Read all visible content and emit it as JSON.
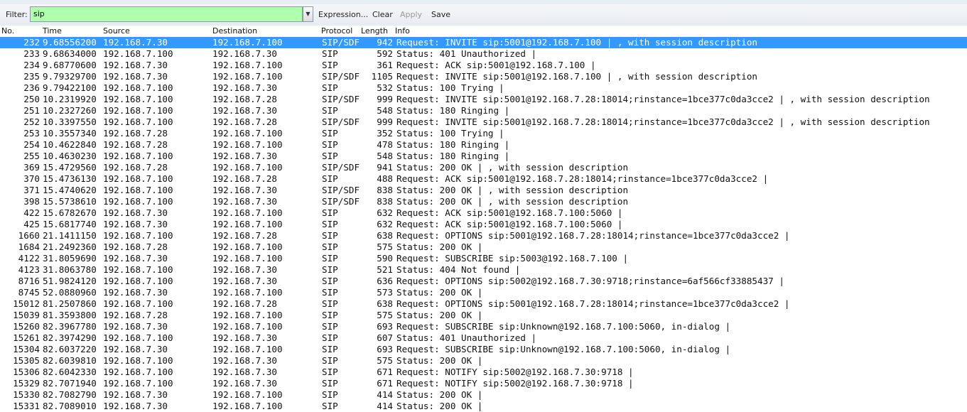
{
  "filter": {
    "label": "Filter:",
    "value": "sip",
    "expression_label": "Expression...",
    "clear_label": "Clear",
    "apply_label": "Apply",
    "save_label": "Save",
    "valid_color": "#afffaf"
  },
  "columns": {
    "no": "No.",
    "time": "Time",
    "source": "Source",
    "destination": "Destination",
    "protocol": "Protocol",
    "length": "Length",
    "info": "Info"
  },
  "selection_color": "#3399ff",
  "packets": [
    {
      "no": "232",
      "time": "9.68556200",
      "src": "192.168.7.30",
      "dst": "192.168.7.100",
      "proto": "SIP/SDF",
      "len": "942",
      "info": "Request: INVITE sip:5001@192.168.7.100 | , with session description",
      "selected": true
    },
    {
      "no": "233",
      "time": "9.68634000",
      "src": "192.168.7.100",
      "dst": "192.168.7.30",
      "proto": "SIP",
      "len": "592",
      "info": "Status: 401 Unauthorized |"
    },
    {
      "no": "234",
      "time": "9.68770600",
      "src": "192.168.7.30",
      "dst": "192.168.7.100",
      "proto": "SIP",
      "len": "361",
      "info": "Request: ACK sip:5001@192.168.7.100 |"
    },
    {
      "no": "235",
      "time": "9.79329700",
      "src": "192.168.7.30",
      "dst": "192.168.7.100",
      "proto": "SIP/SDF",
      "len": "1105",
      "info": "Request: INVITE sip:5001@192.168.7.100 | , with session description"
    },
    {
      "no": "236",
      "time": "9.79422100",
      "src": "192.168.7.100",
      "dst": "192.168.7.30",
      "proto": "SIP",
      "len": "532",
      "info": "Status: 100 Trying |"
    },
    {
      "no": "250",
      "time": "10.2319920",
      "src": "192.168.7.100",
      "dst": "192.168.7.28",
      "proto": "SIP/SDF",
      "len": "999",
      "info": "Request: INVITE sip:5001@192.168.7.28:18014;rinstance=1bce377c0da3cce2 | , with session description"
    },
    {
      "no": "251",
      "time": "10.2327260",
      "src": "192.168.7.100",
      "dst": "192.168.7.30",
      "proto": "SIP",
      "len": "548",
      "info": "Status: 180 Ringing |"
    },
    {
      "no": "252",
      "time": "10.3397550",
      "src": "192.168.7.100",
      "dst": "192.168.7.28",
      "proto": "SIP/SDF",
      "len": "999",
      "info": "Request: INVITE sip:5001@192.168.7.28:18014;rinstance=1bce377c0da3cce2 | , with session description"
    },
    {
      "no": "253",
      "time": "10.3557340",
      "src": "192.168.7.28",
      "dst": "192.168.7.100",
      "proto": "SIP",
      "len": "352",
      "info": "Status: 100 Trying |"
    },
    {
      "no": "254",
      "time": "10.4622840",
      "src": "192.168.7.28",
      "dst": "192.168.7.100",
      "proto": "SIP",
      "len": "478",
      "info": "Status: 180 Ringing |"
    },
    {
      "no": "255",
      "time": "10.4630230",
      "src": "192.168.7.100",
      "dst": "192.168.7.30",
      "proto": "SIP",
      "len": "548",
      "info": "Status: 180 Ringing |"
    },
    {
      "no": "369",
      "time": "15.4729560",
      "src": "192.168.7.28",
      "dst": "192.168.7.100",
      "proto": "SIP/SDF",
      "len": "941",
      "info": "Status: 200 OK | , with session description"
    },
    {
      "no": "370",
      "time": "15.4736130",
      "src": "192.168.7.100",
      "dst": "192.168.7.28",
      "proto": "SIP",
      "len": "488",
      "info": "Request: ACK sip:5001@192.168.7.28:18014;rinstance=1bce377c0da3cce2 |"
    },
    {
      "no": "371",
      "time": "15.4740620",
      "src": "192.168.7.100",
      "dst": "192.168.7.30",
      "proto": "SIP/SDF",
      "len": "838",
      "info": "Status: 200 OK | , with session description"
    },
    {
      "no": "398",
      "time": "15.5738610",
      "src": "192.168.7.100",
      "dst": "192.168.7.30",
      "proto": "SIP/SDF",
      "len": "838",
      "info": "Status: 200 OK | , with session description"
    },
    {
      "no": "422",
      "time": "15.6782670",
      "src": "192.168.7.30",
      "dst": "192.168.7.100",
      "proto": "SIP",
      "len": "632",
      "info": "Request: ACK sip:5001@192.168.7.100:5060 |"
    },
    {
      "no": "425",
      "time": "15.6817740",
      "src": "192.168.7.30",
      "dst": "192.168.7.100",
      "proto": "SIP",
      "len": "632",
      "info": "Request: ACK sip:5001@192.168.7.100:5060 |"
    },
    {
      "no": "1660",
      "time": "21.1411150",
      "src": "192.168.7.100",
      "dst": "192.168.7.28",
      "proto": "SIP",
      "len": "638",
      "info": "Request: OPTIONS sip:5001@192.168.7.28:18014;rinstance=1bce377c0da3cce2 |"
    },
    {
      "no": "1684",
      "time": "21.2492360",
      "src": "192.168.7.28",
      "dst": "192.168.7.100",
      "proto": "SIP",
      "len": "575",
      "info": "Status: 200 OK |"
    },
    {
      "no": "4122",
      "time": "31.8059690",
      "src": "192.168.7.30",
      "dst": "192.168.7.100",
      "proto": "SIP",
      "len": "590",
      "info": "Request: SUBSCRIBE sip:5003@192.168.7.100 |"
    },
    {
      "no": "4123",
      "time": "31.8063780",
      "src": "192.168.7.100",
      "dst": "192.168.7.30",
      "proto": "SIP",
      "len": "521",
      "info": "Status: 404 Not found |"
    },
    {
      "no": "8716",
      "time": "51.9824120",
      "src": "192.168.7.100",
      "dst": "192.168.7.30",
      "proto": "SIP",
      "len": "636",
      "info": "Request: OPTIONS sip:5002@192.168.7.30:9718;rinstance=6af566cf33885437 |"
    },
    {
      "no": "8745",
      "time": "52.0880960",
      "src": "192.168.7.30",
      "dst": "192.168.7.100",
      "proto": "SIP",
      "len": "573",
      "info": "Status: 200 OK |"
    },
    {
      "no": "15012",
      "time": "81.2507860",
      "src": "192.168.7.100",
      "dst": "192.168.7.28",
      "proto": "SIP",
      "len": "638",
      "info": "Request: OPTIONS sip:5001@192.168.7.28:18014;rinstance=1bce377c0da3cce2 |"
    },
    {
      "no": "15039",
      "time": "81.3593800",
      "src": "192.168.7.28",
      "dst": "192.168.7.100",
      "proto": "SIP",
      "len": "575",
      "info": "Status: 200 OK |"
    },
    {
      "no": "15260",
      "time": "82.3967780",
      "src": "192.168.7.30",
      "dst": "192.168.7.100",
      "proto": "SIP",
      "len": "693",
      "info": "Request: SUBSCRIBE sip:Unknown@192.168.7.100:5060, in-dialog |"
    },
    {
      "no": "15261",
      "time": "82.3974290",
      "src": "192.168.7.100",
      "dst": "192.168.7.30",
      "proto": "SIP",
      "len": "607",
      "info": "Status: 401 Unauthorized |"
    },
    {
      "no": "15304",
      "time": "82.6037220",
      "src": "192.168.7.30",
      "dst": "192.168.7.100",
      "proto": "SIP",
      "len": "693",
      "info": "Request: SUBSCRIBE sip:Unknown@192.168.7.100:5060, in-dialog |"
    },
    {
      "no": "15305",
      "time": "82.6039810",
      "src": "192.168.7.100",
      "dst": "192.168.7.30",
      "proto": "SIP",
      "len": "575",
      "info": "Status: 200 OK |"
    },
    {
      "no": "15306",
      "time": "82.6042330",
      "src": "192.168.7.100",
      "dst": "192.168.7.30",
      "proto": "SIP",
      "len": "671",
      "info": "Request: NOTIFY sip:5002@192.168.7.30:9718 |"
    },
    {
      "no": "15329",
      "time": "82.7071940",
      "src": "192.168.7.100",
      "dst": "192.168.7.30",
      "proto": "SIP",
      "len": "671",
      "info": "Request: NOTIFY sip:5002@192.168.7.30:9718 |"
    },
    {
      "no": "15330",
      "time": "82.7082790",
      "src": "192.168.7.30",
      "dst": "192.168.7.100",
      "proto": "SIP",
      "len": "414",
      "info": "Status: 200 OK |"
    },
    {
      "no": "15331",
      "time": "82.7089010",
      "src": "192.168.7.30",
      "dst": "192.168.7.100",
      "proto": "SIP",
      "len": "414",
      "info": "Status: 200 OK |"
    }
  ]
}
